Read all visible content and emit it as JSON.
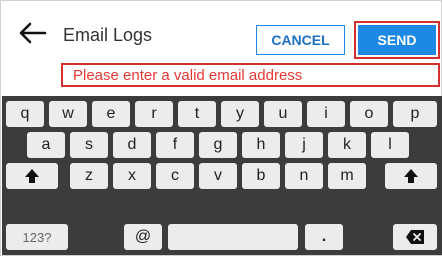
{
  "header": {
    "title": "Email Logs",
    "cancel_label": "CANCEL",
    "send_label": "SEND",
    "back_icon": "arrow-left-icon"
  },
  "error": {
    "message": "Please enter a valid email address"
  },
  "keyboard": {
    "row1": [
      "q",
      "w",
      "e",
      "r",
      "t",
      "y",
      "u",
      "i",
      "o",
      "p"
    ],
    "row2": [
      "a",
      "s",
      "d",
      "f",
      "g",
      "h",
      "j",
      "k",
      "l"
    ],
    "row3": [
      "z",
      "x",
      "c",
      "v",
      "b",
      "n",
      "m"
    ],
    "shift_icon": "shift-up-arrow-icon",
    "numbers_label": "123?",
    "at_label": "@",
    "period_label": ".",
    "backspace_icon": "backspace-icon"
  },
  "colors": {
    "accent": "#1e88e5",
    "error": "#d32f2f",
    "keyboard_bg": "#3c3c3c",
    "key_bg": "#ececec"
  }
}
